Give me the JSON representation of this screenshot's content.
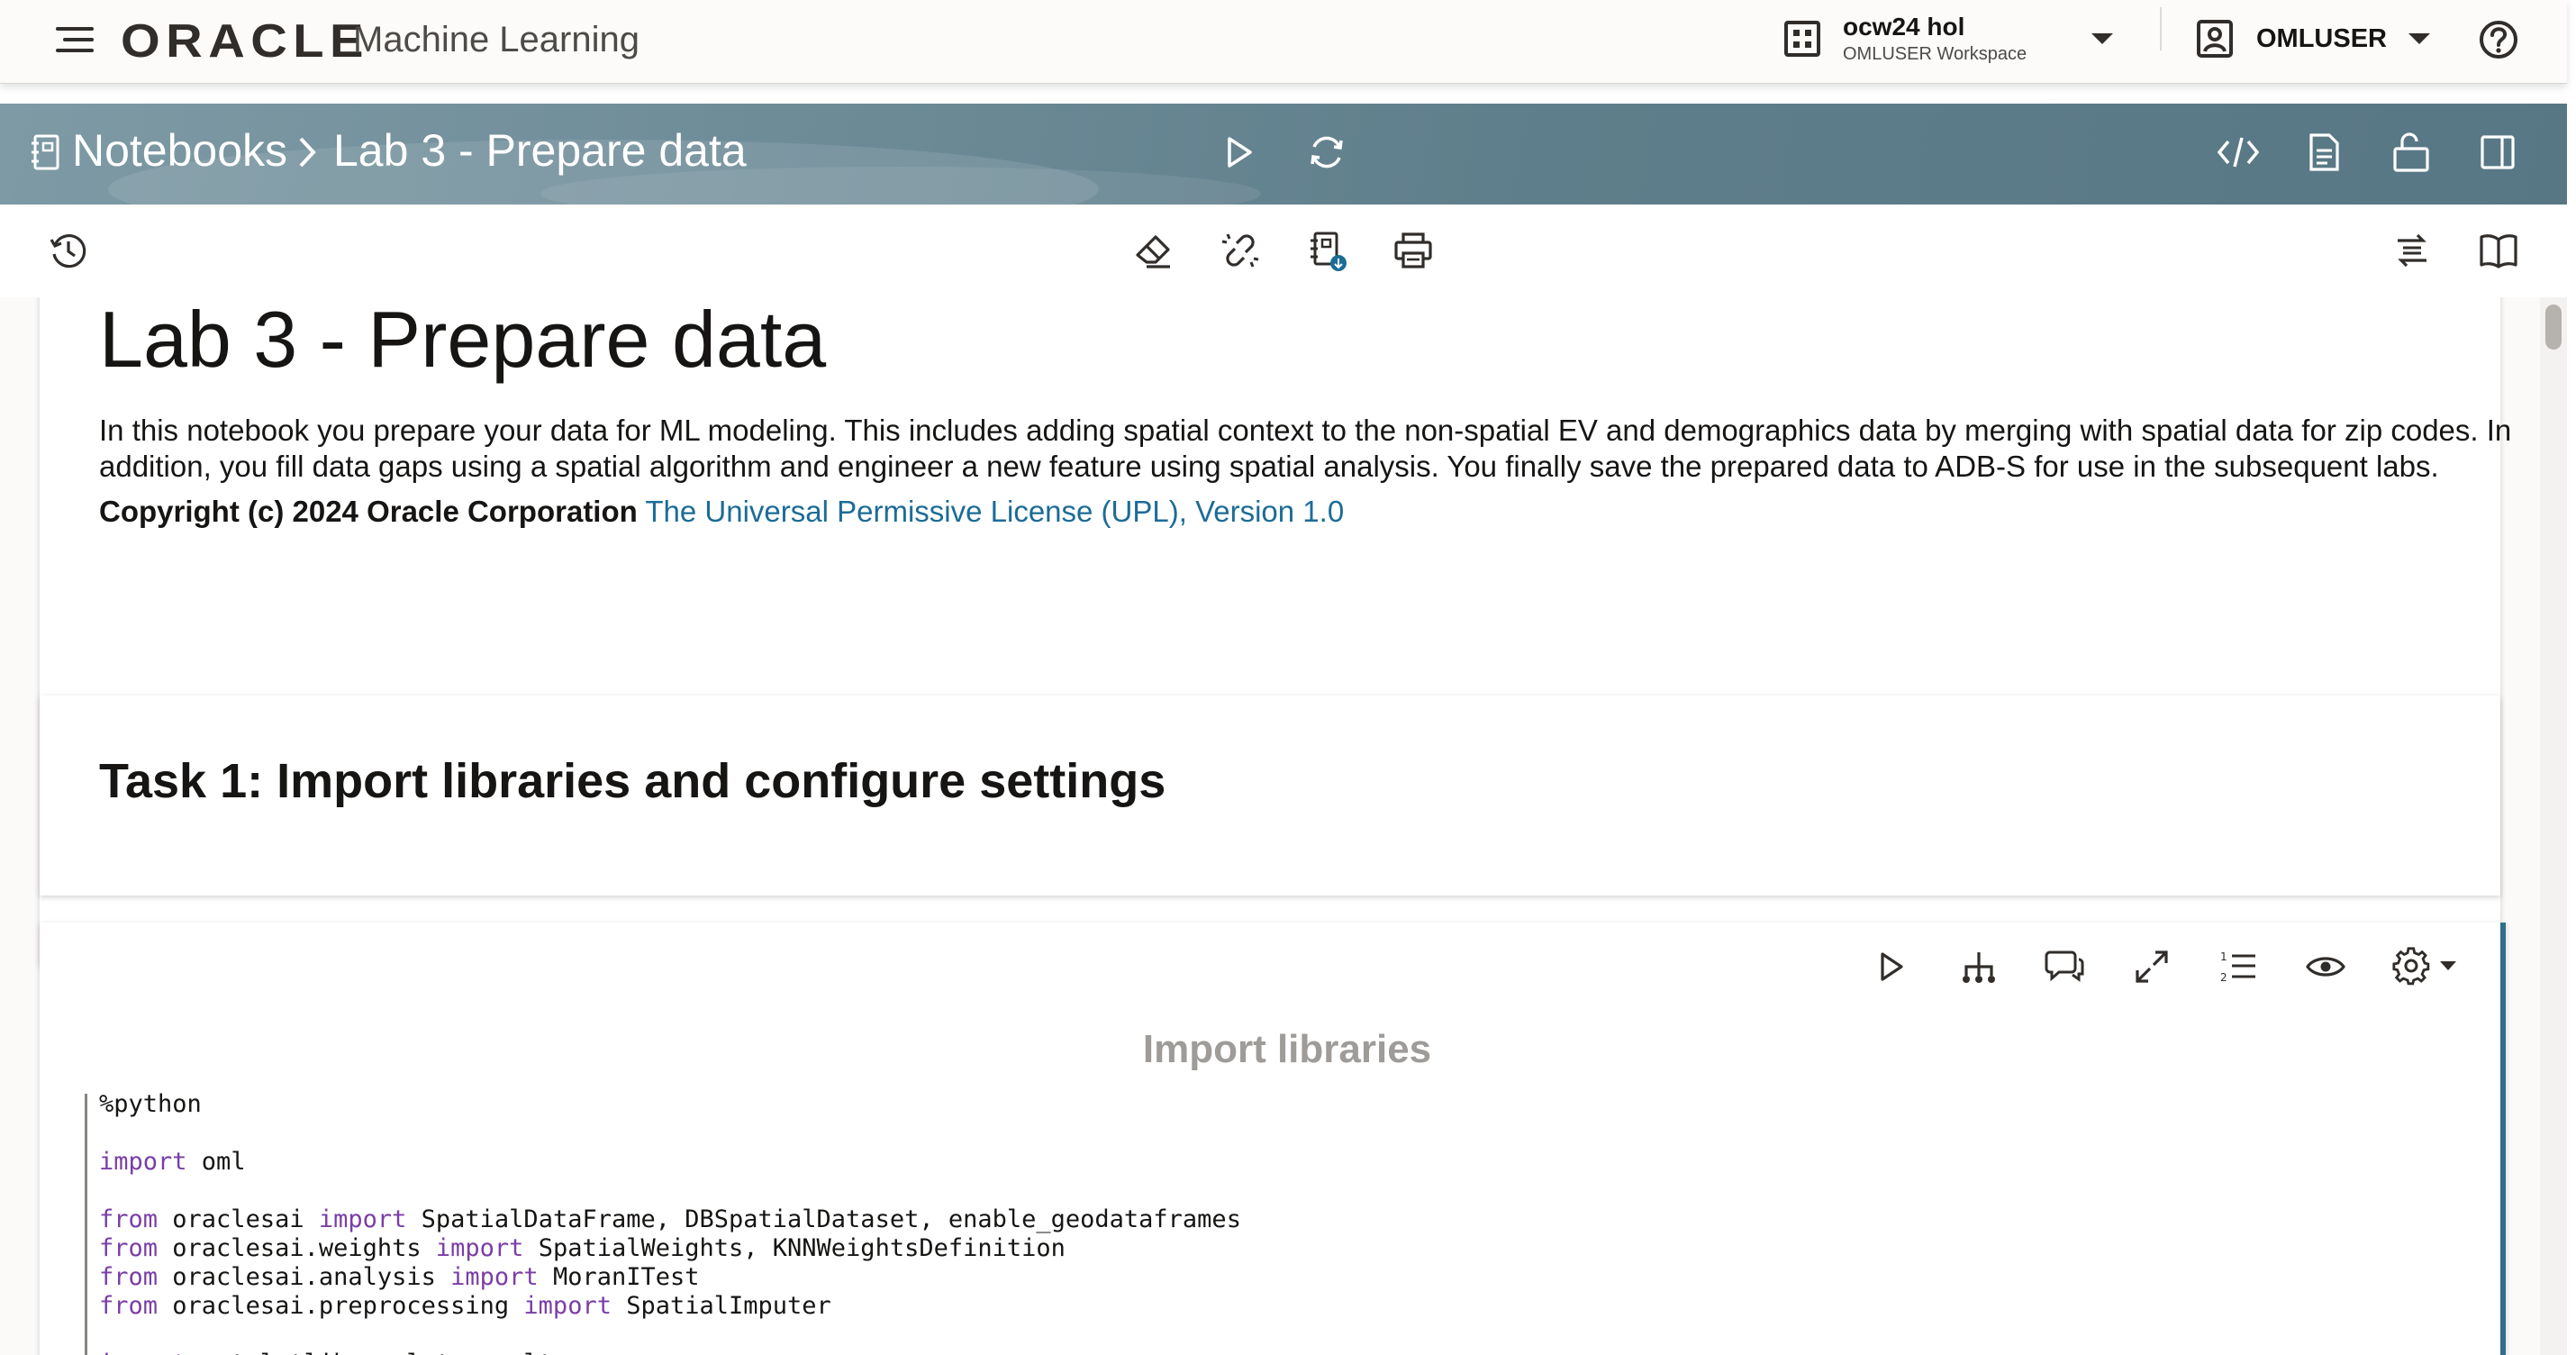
{
  "header": {
    "brand": "ORACLE",
    "app_name": "Machine Learning",
    "workspace_name": "ocw24 hol",
    "workspace_sub": "OMLUSER Workspace",
    "user": "OMLUSER"
  },
  "breadcrumb": {
    "root": "Notebooks",
    "separator": ">",
    "current": "Lab 3 - Prepare data"
  },
  "icons": {
    "menu": "hamburger-icon",
    "workspace": "building-icon",
    "user": "user-badge-icon",
    "help": "help-icon",
    "notebook": "notebook-icon",
    "run": "play-icon",
    "refresh": "refresh-icon",
    "code": "code-icon",
    "document": "document-icon",
    "lock": "unlock-icon",
    "panel": "panel-icon",
    "history": "history-icon",
    "eraser": "eraser-icon",
    "unlink": "unlink-icon",
    "export": "export-notebook-icon",
    "print": "print-icon",
    "transform": "transform-icon",
    "book": "book-icon"
  },
  "paragraphs": {
    "intro": {
      "title": "Lab 3 - Prepare data",
      "body": "In this notebook you prepare your data for ML modeling. This includes adding spatial context to the non-spatial EV and demographics data by merging with spatial data for zip codes. In addition, you fill data gaps using a spatial algorithm and engineer a new feature using spatial analysis. You finally save the prepared data to ADB-S for use in the subsequent labs.",
      "copyright": "Copyright (c) 2024 Oracle Corporation",
      "license_link": "The Universal Permissive License (UPL), Version 1.0"
    },
    "task1": {
      "heading": "Task 1: Import libraries and configure settings"
    },
    "code1": {
      "title": "Import libraries",
      "lines": [
        {
          "kw": "",
          "text": "%python"
        },
        {
          "kw": "",
          "text": ""
        },
        {
          "kw": "import",
          "text": " oml"
        },
        {
          "kw": "",
          "text": ""
        },
        {
          "kw": "from",
          "pre": " oraclesai ",
          "kw2": "import",
          "text": " SpatialDataFrame, DBSpatialDataset, enable_geodataframes"
        },
        {
          "kw": "from",
          "pre": " oraclesai.weights ",
          "kw2": "import",
          "text": " SpatialWeights, KNNWeightsDefinition"
        },
        {
          "kw": "from",
          "pre": " oraclesai.analysis ",
          "kw2": "import",
          "text": " MoranITest"
        },
        {
          "kw": "from",
          "pre": " oraclesai.preprocessing ",
          "kw2": "import",
          "text": " SpatialImputer"
        },
        {
          "kw": "",
          "text": ""
        },
        {
          "kw": "import",
          "pre": " matplotlib.pyplot ",
          "kw2": "as",
          "text": " plt"
        }
      ]
    }
  },
  "colors": {
    "titlebar": "#6a8894",
    "link": "#1c6c96",
    "keyword": "#7a3ea6",
    "focus_border": "#2f6f8c"
  }
}
